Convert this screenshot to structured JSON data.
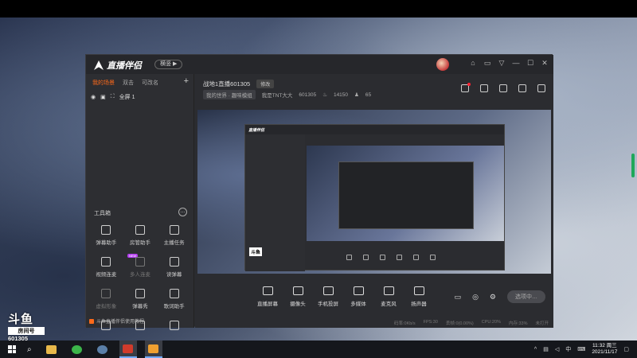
{
  "app": {
    "logo_text": "直播伴侣",
    "badge": "横竖 ▶",
    "window_controls": [
      "⌂",
      "▭",
      "▽",
      "—",
      "☐",
      "✕"
    ]
  },
  "sidebar": {
    "tabs": [
      "我的场景",
      "双击",
      "可改名"
    ],
    "add_label": "+",
    "scene_label": "全屏 1",
    "tools_header": "工具箱",
    "tools_more": "…",
    "tools": [
      {
        "label": "弹幕助手",
        "dim": false
      },
      {
        "label": "房管助手",
        "dim": false
      },
      {
        "label": "主播任务",
        "dim": false
      },
      {
        "label": "视频连麦",
        "dim": false,
        "new": "NEW"
      },
      {
        "label": "多人连麦",
        "dim": true
      },
      {
        "label": "读弹幕",
        "dim": false
      },
      {
        "label": "虚拟形象",
        "dim": true
      },
      {
        "label": "弹幕秀",
        "dim": false
      },
      {
        "label": "歌词助手",
        "dim": false
      },
      {
        "label": "",
        "dim": false
      },
      {
        "label": "",
        "dim": false
      },
      {
        "label": "",
        "dim": false
      }
    ],
    "footer": "斗鱼直播伴侣使用教程"
  },
  "main": {
    "room_title": "战地1直播601305",
    "edit_label": "修改",
    "category": "我的世界 · 趣味模组",
    "streamer": "我是TNT大大",
    "room_id": "601305",
    "heat": "14150",
    "fans": "65"
  },
  "bottom_bar": [
    "直播屏幕",
    "摄像头",
    "手机投屏",
    "多媒体",
    "麦克风",
    "扬声器"
  ],
  "start_button": "选项中…",
  "status": [
    "码率:0Kb/s",
    "FPS:30",
    "丢帧:0(0.00%)",
    "CPU:20%",
    "内存:33%",
    "未打开"
  ],
  "watermark": {
    "brand": "斗鱼",
    "room_label": "房间号",
    "room_number": "601305"
  },
  "taskbar": {
    "time": "11:32 周三",
    "date": "2021/11/17",
    "ime": "中"
  },
  "colors": {
    "accent": "#ff6a1a",
    "window_bg": "#2b2c30"
  }
}
